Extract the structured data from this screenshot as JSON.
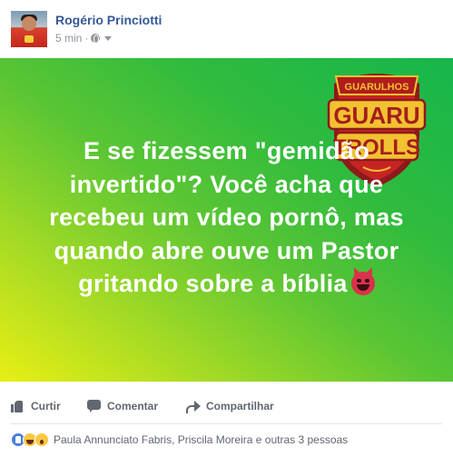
{
  "post": {
    "author_name": "Rogério Princiotti",
    "timestamp": "5 min",
    "separator": "·",
    "privacy_icon": "globe-icon",
    "menu_icon": "caret-down-icon"
  },
  "image": {
    "text": "E se fizessem \"gemidão invertido\"? Você acha que recebeu um vídeo pornô, mas quando abre ouve um Pastor gritando sobre a bíblia",
    "emoji": "devil-icon",
    "gradient_colors": [
      "#e8ef14",
      "#5ac534",
      "#16b64c"
    ],
    "logo": {
      "top_text": "GUARULHOS",
      "middle_text": "GUARU",
      "bottom_text": "TROLLS"
    }
  },
  "actions": {
    "like_label": "Curtir",
    "comment_label": "Comentar",
    "share_label": "Compartilhar"
  },
  "reactions": {
    "icons": [
      "like-icon",
      "haha-icon",
      "wow-icon"
    ],
    "summary": "Paula Annunciato Fabris, Priscila Moreira e outras 3 pessoas"
  },
  "colors": {
    "link": "#365899",
    "muted": "#90949c",
    "action_text": "#606770",
    "logo_red": "#a51d1d",
    "logo_gold": "#f2c230"
  }
}
